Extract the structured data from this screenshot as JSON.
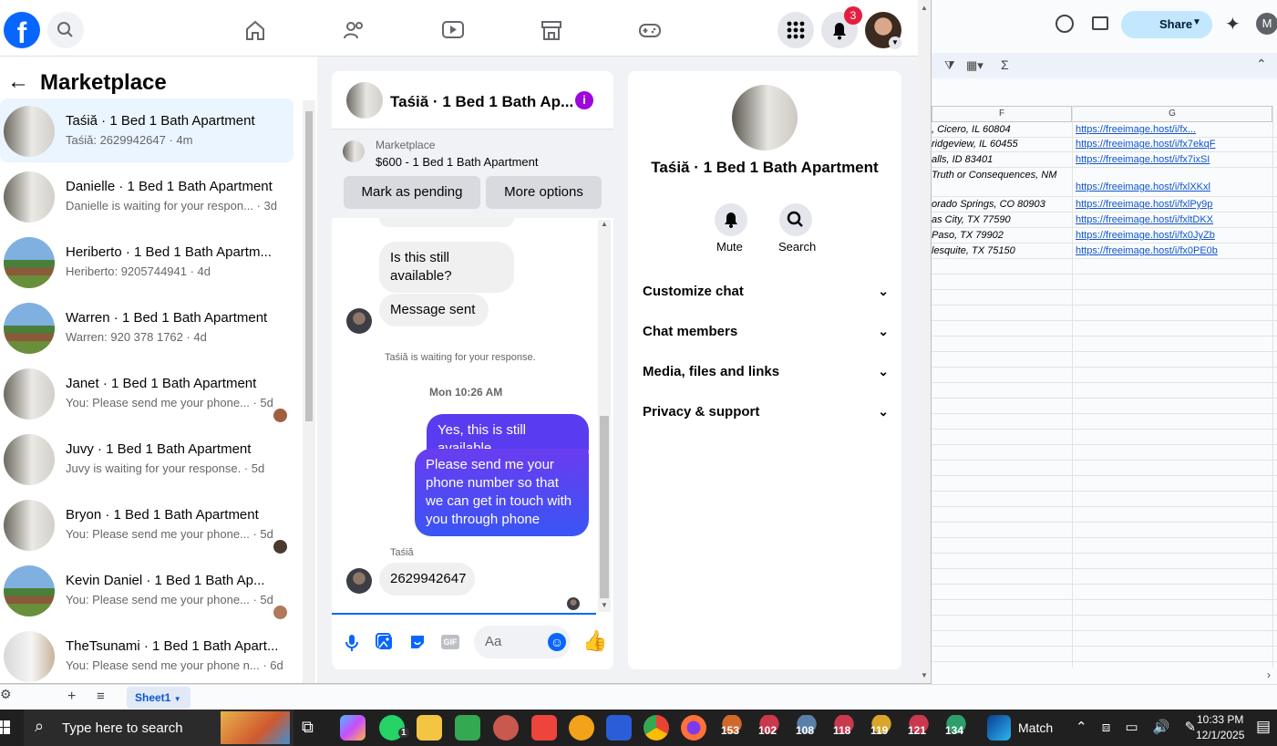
{
  "facebook": {
    "notifications_count": "3",
    "marketplace_title": "Marketplace",
    "conversations": [
      {
        "title": "Taśiă · 1 Bed 1 Bath Apartment",
        "subtitle": "Taśiă: 2629942647 · 4m"
      },
      {
        "title": "Danielle · 1 Bed 1 Bath Apartment",
        "subtitle": "Danielle is waiting for your respon... · 3d"
      },
      {
        "title": "Heriberto · 1 Bed 1 Bath Apartm...",
        "subtitle": "Heriberto: 9205744941 · 4d"
      },
      {
        "title": "Warren · 1 Bed 1 Bath Apartment",
        "subtitle": "Warren: 920 378 1762 · 4d"
      },
      {
        "title": "Janet · 1 Bed 1 Bath Apartment",
        "subtitle": "You: Please send me your phone... · 5d"
      },
      {
        "title": "Juvy · 1 Bed 1 Bath Apartment",
        "subtitle": "Juvy is waiting for your response. · 5d"
      },
      {
        "title": "Bryon · 1 Bed 1 Bath Apartment",
        "subtitle": "You: Please send me your phone... · 5d"
      },
      {
        "title": "Kevin Daniel · 1 Bed 1 Bath Ap...",
        "subtitle": "You: Please send me your phone... · 5d"
      },
      {
        "title": "TheTsunami · 1 Bed 1 Bath Apart...",
        "subtitle": "You: Please send me your phone n... · 6d"
      }
    ],
    "chat": {
      "header_title": "Taśiă · 1 Bed 1 Bath Ap...",
      "listing_source": "Marketplace",
      "listing_detail": "$600 - 1 Bed 1 Bath Apartment",
      "mark_pending": "Mark as pending",
      "more_options": "More options",
      "msg_still_available": "Is this still available?",
      "msg_sent": "Message sent",
      "waiting_note": "Taśiă is waiting for your response.",
      "timestamp": "Mon 10:26 AM",
      "out_1": "Yes, this is still available",
      "out_2": "Please send me your phone  number so that we can get in touch with you through phone",
      "sender_name": "Taśiă",
      "in_phone": "2629942647",
      "composer_placeholder": "Aa",
      "gif_label": "GIF"
    },
    "info": {
      "title": "Taśiă · 1 Bed 1 Bath Apartment",
      "mute": "Mute",
      "search": "Search",
      "sections": [
        "Customize chat",
        "Chat members",
        "Media, files and links",
        "Privacy & support"
      ]
    }
  },
  "sheet": {
    "share_label": "Share",
    "avatar_letter": "M",
    "col_f": "F",
    "col_g": "G",
    "rows": [
      {
        "f": ", Cicero, IL 60804",
        "g": "https://freeimage.host/i/fx..."
      },
      {
        "f": "ridgeview, IL 60455",
        "g": "https://freeimage.host/i/fx7ekqF"
      },
      {
        "f": "alls, ID 83401",
        "g": "https://freeimage.host/i/fx7ixSI"
      },
      {
        "f": "Truth or Consequences, NM",
        "g": "https://freeimage.host/i/fxlXKxl"
      },
      {
        "f": "orado Springs, CO 80903",
        "g": "https://freeimage.host/i/fxlPy9p"
      },
      {
        "f": "as City, TX 77590",
        "g": "https://freeimage.host/i/fxltDKX"
      },
      {
        "f": "Paso, TX 79902",
        "g": "https://freeimage.host/i/fx0JyZb"
      },
      {
        "f": "lesquite, TX 75150",
        "g": "https://freeimage.host/i/fx0PE0b"
      }
    ],
    "tab_name": "Sheet1"
  },
  "taskbar": {
    "search_placeholder": "Type here to search",
    "badges": [
      "153",
      "102",
      "108",
      "118",
      "119",
      "121",
      "134"
    ],
    "match_label": "Match",
    "time": "10:33 PM",
    "date": "12/1/2025",
    "whatsapp_badge": "1"
  }
}
